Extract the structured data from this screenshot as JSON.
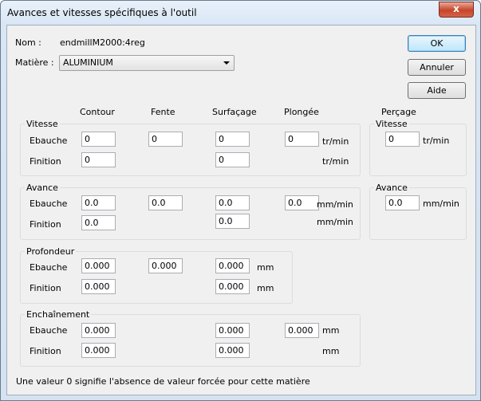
{
  "window": {
    "title": "Avances et vitesses spécifiques à l'outil",
    "close": "x"
  },
  "nom": {
    "label": "Nom :",
    "value": "endmillM2000:4reg"
  },
  "matiere": {
    "label": "Matière :",
    "value": "ALUMINIUM"
  },
  "buttons": {
    "ok": "OK",
    "annuler": "Annuler",
    "aide": "Aide"
  },
  "columns": {
    "contour": "Contour",
    "fente": "Fente",
    "surfacage": "Surfaçage",
    "plongee": "Plongée",
    "percage": "Perçage"
  },
  "rows": {
    "ebauche": "Ebauche",
    "finition": "Finition"
  },
  "units": {
    "trmin": "tr/min",
    "mmmin": "mm/min",
    "mm": "mm"
  },
  "vitesse": {
    "title": "Vitesse",
    "ebauche": {
      "contour": "0",
      "fente": "0",
      "surfacage": "0",
      "plongee": "0"
    },
    "finition": {
      "contour": "0",
      "surfacage": "0"
    }
  },
  "avance": {
    "title": "Avance",
    "ebauche": {
      "contour": "0.0",
      "fente": "0.0",
      "surfacage": "0.0",
      "plongee": "0.0"
    },
    "finition": {
      "contour": "0.0",
      "surfacage": "0.0"
    }
  },
  "profondeur": {
    "title": "Profondeur",
    "ebauche": {
      "contour": "0.000",
      "fente": "0.000",
      "surfacage": "0.000"
    },
    "finition": {
      "contour": "0.000",
      "surfacage": "0.000"
    }
  },
  "enchainement": {
    "title": "Enchaînement",
    "ebauche": {
      "contour": "0.000",
      "surfacage": "0.000",
      "plongee": "0.000"
    },
    "finition": {
      "contour": "0.000",
      "surfacage": "0.000"
    }
  },
  "percage": {
    "vitesse_title": "Vitesse",
    "vitesse": "0",
    "avance_title": "Avance",
    "avance": "0.0"
  },
  "footer": "Une valeur 0 signifie l'absence de valeur forcée pour cette matière"
}
